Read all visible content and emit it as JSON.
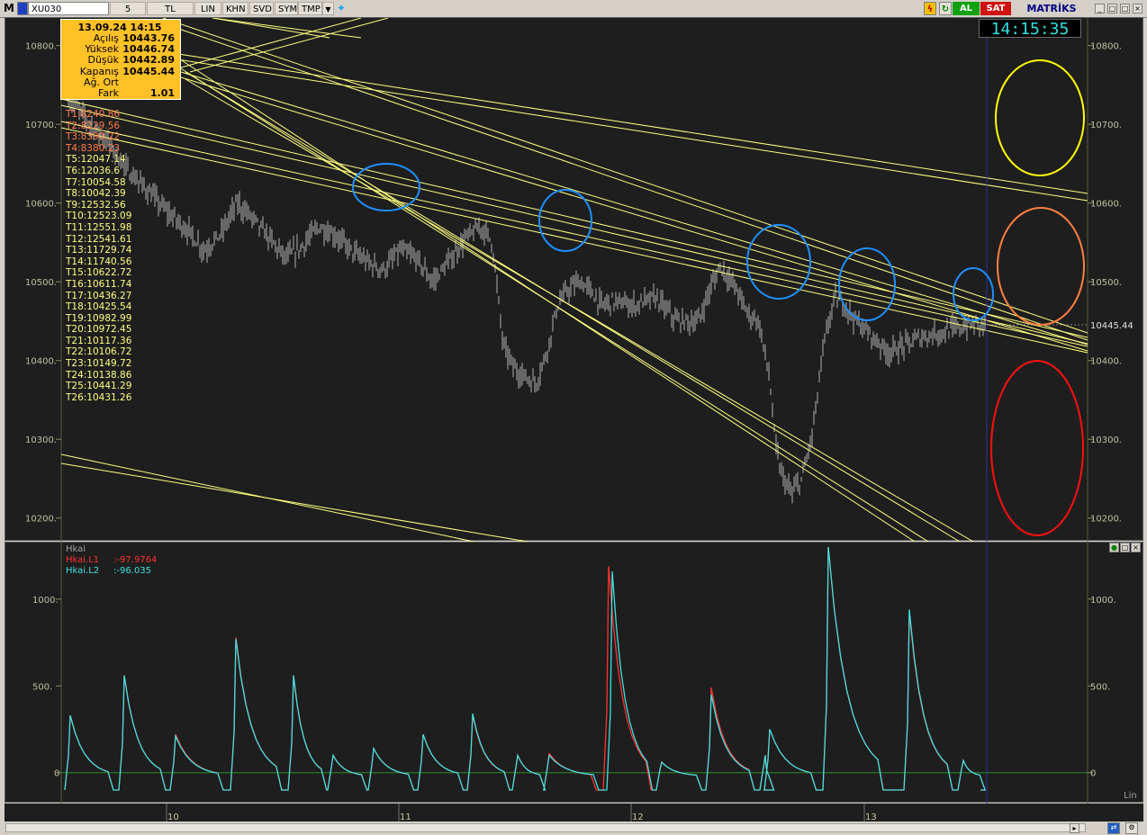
{
  "toolbar": {
    "logo": "M",
    "symbol": "XU030",
    "period": "5",
    "currency": "TL",
    "buttons": [
      "LIN",
      "KHN",
      "SVD",
      "SYM",
      "TMP"
    ],
    "dropdown_arrow": "▼",
    "twitter_icon": "twitter-icon",
    "buy_label": "AL",
    "sell_label": "SAT",
    "brand": "MATRİKS",
    "brand_color": "#000080"
  },
  "info_box": {
    "date": "13.09.24 14:15",
    "rows": [
      {
        "label": "Açılış",
        "value": "10443.76"
      },
      {
        "label": "Yüksek",
        "value": "10446.74"
      },
      {
        "label": "Düşük",
        "value": "10442.89"
      },
      {
        "label": "Kapanış",
        "value": "10445.44"
      },
      {
        "label": "Ağ. Ort",
        "value": ""
      },
      {
        "label": "Fark",
        "value": "1.01"
      }
    ]
  },
  "clock": "14:15:35",
  "trend_lines_list": [
    {
      "text": "T1:8240.86",
      "color": "#ff7d4a"
    },
    {
      "text": "T2:8229.56",
      "color": "#ff7d4a"
    },
    {
      "text": "T3:8390.22",
      "color": "#ff7d4a"
    },
    {
      "text": "T4:8380.23",
      "color": "#ff7d4a"
    },
    {
      "text": "T5:12047.14",
      "color": "#ffff80"
    },
    {
      "text": "T6:12036.6",
      "color": "#ffff80"
    },
    {
      "text": "T7:10054.58",
      "color": "#ffff80"
    },
    {
      "text": "T8:10042.39",
      "color": "#ffff80"
    },
    {
      "text": "T9:12532.56",
      "color": "#ffff80"
    },
    {
      "text": "T10:12523.09",
      "color": "#ffff80"
    },
    {
      "text": "T11:12551.98",
      "color": "#ffff80"
    },
    {
      "text": "T12:12541.61",
      "color": "#ffff80"
    },
    {
      "text": "T13:11729.74",
      "color": "#ffff80"
    },
    {
      "text": "T14:11740.56",
      "color": "#ffff80"
    },
    {
      "text": "T15:10622.72",
      "color": "#ffff80"
    },
    {
      "text": "T16:10611.74",
      "color": "#ffff80"
    },
    {
      "text": "T17:10436.27",
      "color": "#ffff80"
    },
    {
      "text": "T18:10425.54",
      "color": "#ffff80"
    },
    {
      "text": "T19:10982.99",
      "color": "#ffff80"
    },
    {
      "text": "T20:10972.45",
      "color": "#ffff80"
    },
    {
      "text": "T21:10117.36",
      "color": "#ffff80"
    },
    {
      "text": "T22:10106.72",
      "color": "#ffff80"
    },
    {
      "text": "T23:10149.72",
      "color": "#ffff80"
    },
    {
      "text": "T24:10138.86",
      "color": "#ffff80"
    },
    {
      "text": "T25:10441.29",
      "color": "#ffff80"
    },
    {
      "text": "T26:10431.26",
      "color": "#ffff80"
    }
  ],
  "price_axis": {
    "ticks": [
      "10800.",
      "10700.",
      "10600.",
      "10500.",
      "10400.",
      "10300.",
      "10200."
    ],
    "tick_values": [
      10800,
      10700,
      10600,
      10500,
      10400,
      10300,
      10200
    ],
    "last_price_label": "10445.44",
    "last_price": 10445.44
  },
  "indicator": {
    "name": "Hkai",
    "series": [
      {
        "label": "Hkai.L1",
        "value": ":-97.9764",
        "color": "#ff3030"
      },
      {
        "label": "Hkai.L2",
        "value": ":-96.035",
        "color": "#40e0e0"
      }
    ],
    "ticks": [
      "1000.",
      "500.",
      "0"
    ],
    "tick_values": [
      1000,
      500,
      0
    ],
    "scale_label": "Lin"
  },
  "date_axis": [
    "10",
    "11",
    "12",
    "13"
  ],
  "chart_data": [
    {
      "type": "candlestick",
      "title": "XU030",
      "period": "5",
      "xlabel": "",
      "ylabel": "",
      "ylim": [
        10170,
        10835
      ],
      "x": [
        "10",
        "11",
        "12",
        "13"
      ],
      "anchors": [
        [
          0,
          10735
        ],
        [
          20,
          10700
        ],
        [
          35,
          10680
        ],
        [
          55,
          10640
        ],
        [
          70,
          10620
        ],
        [
          90,
          10590
        ],
        [
          110,
          10565
        ],
        [
          125,
          10540
        ],
        [
          140,
          10560
        ],
        [
          155,
          10600
        ],
        [
          170,
          10580
        ],
        [
          185,
          10555
        ],
        [
          200,
          10530
        ],
        [
          215,
          10545
        ],
        [
          230,
          10570
        ],
        [
          245,
          10560
        ],
        [
          260,
          10540
        ],
        [
          275,
          10525
        ],
        [
          290,
          10515
        ],
        [
          305,
          10540
        ],
        [
          320,
          10530
        ],
        [
          335,
          10500
        ],
        [
          350,
          10525
        ],
        [
          365,
          10555
        ],
        [
          380,
          10570
        ],
        [
          390,
          10550
        ],
        [
          400,
          10420
        ],
        [
          410,
          10390
        ],
        [
          420,
          10380
        ],
        [
          430,
          10370
        ],
        [
          440,
          10410
        ],
        [
          450,
          10470
        ],
        [
          460,
          10490
        ],
        [
          470,
          10500
        ],
        [
          480,
          10490
        ],
        [
          490,
          10470
        ],
        [
          500,
          10475
        ],
        [
          520,
          10470
        ],
        [
          540,
          10480
        ],
        [
          560,
          10450
        ],
        [
          580,
          10450
        ],
        [
          590,
          10490
        ],
        [
          600,
          10520
        ],
        [
          615,
          10490
        ],
        [
          625,
          10460
        ],
        [
          635,
          10450
        ],
        [
          645,
          10380
        ],
        [
          650,
          10300
        ],
        [
          655,
          10260
        ],
        [
          665,
          10230
        ],
        [
          675,
          10250
        ],
        [
          685,
          10310
        ],
        [
          695,
          10420
        ],
        [
          705,
          10480
        ],
        [
          715,
          10470
        ],
        [
          725,
          10450
        ],
        [
          740,
          10430
        ],
        [
          755,
          10410
        ],
        [
          770,
          10420
        ],
        [
          785,
          10430
        ],
        [
          800,
          10435
        ],
        [
          815,
          10440
        ],
        [
          830,
          10445
        ],
        [
          845,
          10447
        ]
      ]
    },
    {
      "type": "line",
      "title": "Hkai",
      "xlabel": "",
      "ylabel": "",
      "ylim": [
        -100,
        1300
      ],
      "series": [
        {
          "name": "Hkai.L1",
          "color": "#ff3030"
        },
        {
          "name": "Hkai.L2",
          "color": "#40e0e0"
        }
      ],
      "spikes_L2": [
        [
          8,
          330
        ],
        [
          68,
          560
        ],
        [
          125,
          210
        ],
        [
          192,
          770
        ],
        [
          256,
          560
        ],
        [
          300,
          100
        ],
        [
          345,
          140
        ],
        [
          400,
          220
        ],
        [
          455,
          340
        ],
        [
          505,
          100
        ],
        [
          540,
          100
        ],
        [
          610,
          1160
        ],
        [
          665,
          60
        ],
        [
          720,
          450
        ],
        [
          780,
          100
        ],
        [
          785,
          250
        ],
        [
          850,
          1300
        ],
        [
          940,
          940
        ],
        [
          1000,
          70
        ]
      ],
      "spikes_L1": [
        [
          8,
          330
        ],
        [
          68,
          560
        ],
        [
          125,
          220
        ],
        [
          192,
          780
        ],
        [
          256,
          560
        ],
        [
          300,
          100
        ],
        [
          345,
          140
        ],
        [
          400,
          220
        ],
        [
          455,
          330
        ],
        [
          505,
          100
        ],
        [
          540,
          110
        ],
        [
          606,
          1190
        ],
        [
          665,
          60
        ],
        [
          720,
          490
        ],
        [
          780,
          100
        ],
        [
          785,
          250
        ],
        [
          850,
          1300
        ],
        [
          940,
          920
        ],
        [
          1000,
          70
        ]
      ]
    }
  ],
  "colors": {
    "background": "#1e1e1e",
    "trendline": "#ffff80",
    "candle": "#b0b0b0",
    "grid": "#d0d070",
    "circle_blue": "#1e90ff",
    "circle_yellow": "#ffff00",
    "circle_orange": "#ff8040",
    "circle_red": "#ff1010",
    "cursor_line": "#3030a0",
    "zero_line": "#2a8a2a"
  }
}
